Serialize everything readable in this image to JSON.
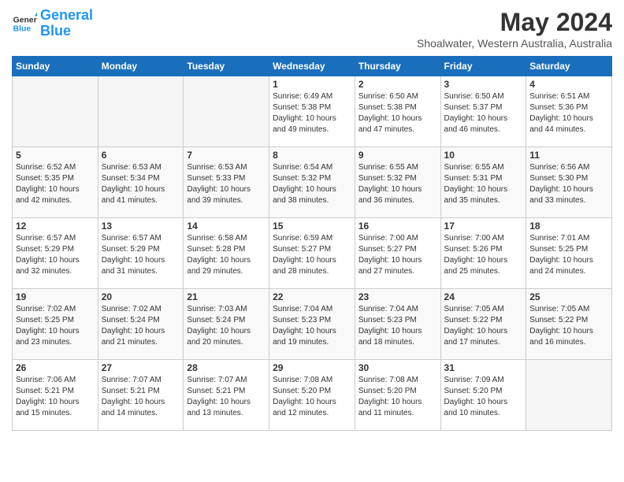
{
  "header": {
    "logo_general": "General",
    "logo_blue": "Blue",
    "month_title": "May 2024",
    "location": "Shoalwater, Western Australia, Australia"
  },
  "weekdays": [
    "Sunday",
    "Monday",
    "Tuesday",
    "Wednesday",
    "Thursday",
    "Friday",
    "Saturday"
  ],
  "weeks": [
    {
      "days": [
        {
          "num": "",
          "empty": true
        },
        {
          "num": "",
          "empty": true
        },
        {
          "num": "",
          "empty": true
        },
        {
          "num": "1",
          "sunrise": "Sunrise: 6:49 AM",
          "sunset": "Sunset: 5:38 PM",
          "daylight": "Daylight: 10 hours and 49 minutes."
        },
        {
          "num": "2",
          "sunrise": "Sunrise: 6:50 AM",
          "sunset": "Sunset: 5:38 PM",
          "daylight": "Daylight: 10 hours and 47 minutes."
        },
        {
          "num": "3",
          "sunrise": "Sunrise: 6:50 AM",
          "sunset": "Sunset: 5:37 PM",
          "daylight": "Daylight: 10 hours and 46 minutes."
        },
        {
          "num": "4",
          "sunrise": "Sunrise: 6:51 AM",
          "sunset": "Sunset: 5:36 PM",
          "daylight": "Daylight: 10 hours and 44 minutes."
        }
      ]
    },
    {
      "days": [
        {
          "num": "5",
          "sunrise": "Sunrise: 6:52 AM",
          "sunset": "Sunset: 5:35 PM",
          "daylight": "Daylight: 10 hours and 42 minutes."
        },
        {
          "num": "6",
          "sunrise": "Sunrise: 6:53 AM",
          "sunset": "Sunset: 5:34 PM",
          "daylight": "Daylight: 10 hours and 41 minutes."
        },
        {
          "num": "7",
          "sunrise": "Sunrise: 6:53 AM",
          "sunset": "Sunset: 5:33 PM",
          "daylight": "Daylight: 10 hours and 39 minutes."
        },
        {
          "num": "8",
          "sunrise": "Sunrise: 6:54 AM",
          "sunset": "Sunset: 5:32 PM",
          "daylight": "Daylight: 10 hours and 38 minutes."
        },
        {
          "num": "9",
          "sunrise": "Sunrise: 6:55 AM",
          "sunset": "Sunset: 5:32 PM",
          "daylight": "Daylight: 10 hours and 36 minutes."
        },
        {
          "num": "10",
          "sunrise": "Sunrise: 6:55 AM",
          "sunset": "Sunset: 5:31 PM",
          "daylight": "Daylight: 10 hours and 35 minutes."
        },
        {
          "num": "11",
          "sunrise": "Sunrise: 6:56 AM",
          "sunset": "Sunset: 5:30 PM",
          "daylight": "Daylight: 10 hours and 33 minutes."
        }
      ]
    },
    {
      "days": [
        {
          "num": "12",
          "sunrise": "Sunrise: 6:57 AM",
          "sunset": "Sunset: 5:29 PM",
          "daylight": "Daylight: 10 hours and 32 minutes."
        },
        {
          "num": "13",
          "sunrise": "Sunrise: 6:57 AM",
          "sunset": "Sunset: 5:29 PM",
          "daylight": "Daylight: 10 hours and 31 minutes."
        },
        {
          "num": "14",
          "sunrise": "Sunrise: 6:58 AM",
          "sunset": "Sunset: 5:28 PM",
          "daylight": "Daylight: 10 hours and 29 minutes."
        },
        {
          "num": "15",
          "sunrise": "Sunrise: 6:59 AM",
          "sunset": "Sunset: 5:27 PM",
          "daylight": "Daylight: 10 hours and 28 minutes."
        },
        {
          "num": "16",
          "sunrise": "Sunrise: 7:00 AM",
          "sunset": "Sunset: 5:27 PM",
          "daylight": "Daylight: 10 hours and 27 minutes."
        },
        {
          "num": "17",
          "sunrise": "Sunrise: 7:00 AM",
          "sunset": "Sunset: 5:26 PM",
          "daylight": "Daylight: 10 hours and 25 minutes."
        },
        {
          "num": "18",
          "sunrise": "Sunrise: 7:01 AM",
          "sunset": "Sunset: 5:25 PM",
          "daylight": "Daylight: 10 hours and 24 minutes."
        }
      ]
    },
    {
      "days": [
        {
          "num": "19",
          "sunrise": "Sunrise: 7:02 AM",
          "sunset": "Sunset: 5:25 PM",
          "daylight": "Daylight: 10 hours and 23 minutes."
        },
        {
          "num": "20",
          "sunrise": "Sunrise: 7:02 AM",
          "sunset": "Sunset: 5:24 PM",
          "daylight": "Daylight: 10 hours and 21 minutes."
        },
        {
          "num": "21",
          "sunrise": "Sunrise: 7:03 AM",
          "sunset": "Sunset: 5:24 PM",
          "daylight": "Daylight: 10 hours and 20 minutes."
        },
        {
          "num": "22",
          "sunrise": "Sunrise: 7:04 AM",
          "sunset": "Sunset: 5:23 PM",
          "daylight": "Daylight: 10 hours and 19 minutes."
        },
        {
          "num": "23",
          "sunrise": "Sunrise: 7:04 AM",
          "sunset": "Sunset: 5:23 PM",
          "daylight": "Daylight: 10 hours and 18 minutes."
        },
        {
          "num": "24",
          "sunrise": "Sunrise: 7:05 AM",
          "sunset": "Sunset: 5:22 PM",
          "daylight": "Daylight: 10 hours and 17 minutes."
        },
        {
          "num": "25",
          "sunrise": "Sunrise: 7:05 AM",
          "sunset": "Sunset: 5:22 PM",
          "daylight": "Daylight: 10 hours and 16 minutes."
        }
      ]
    },
    {
      "days": [
        {
          "num": "26",
          "sunrise": "Sunrise: 7:06 AM",
          "sunset": "Sunset: 5:21 PM",
          "daylight": "Daylight: 10 hours and 15 minutes."
        },
        {
          "num": "27",
          "sunrise": "Sunrise: 7:07 AM",
          "sunset": "Sunset: 5:21 PM",
          "daylight": "Daylight: 10 hours and 14 minutes."
        },
        {
          "num": "28",
          "sunrise": "Sunrise: 7:07 AM",
          "sunset": "Sunset: 5:21 PM",
          "daylight": "Daylight: 10 hours and 13 minutes."
        },
        {
          "num": "29",
          "sunrise": "Sunrise: 7:08 AM",
          "sunset": "Sunset: 5:20 PM",
          "daylight": "Daylight: 10 hours and 12 minutes."
        },
        {
          "num": "30",
          "sunrise": "Sunrise: 7:08 AM",
          "sunset": "Sunset: 5:20 PM",
          "daylight": "Daylight: 10 hours and 11 minutes."
        },
        {
          "num": "31",
          "sunrise": "Sunrise: 7:09 AM",
          "sunset": "Sunset: 5:20 PM",
          "daylight": "Daylight: 10 hours and 10 minutes."
        },
        {
          "num": "",
          "empty": true
        }
      ]
    }
  ]
}
